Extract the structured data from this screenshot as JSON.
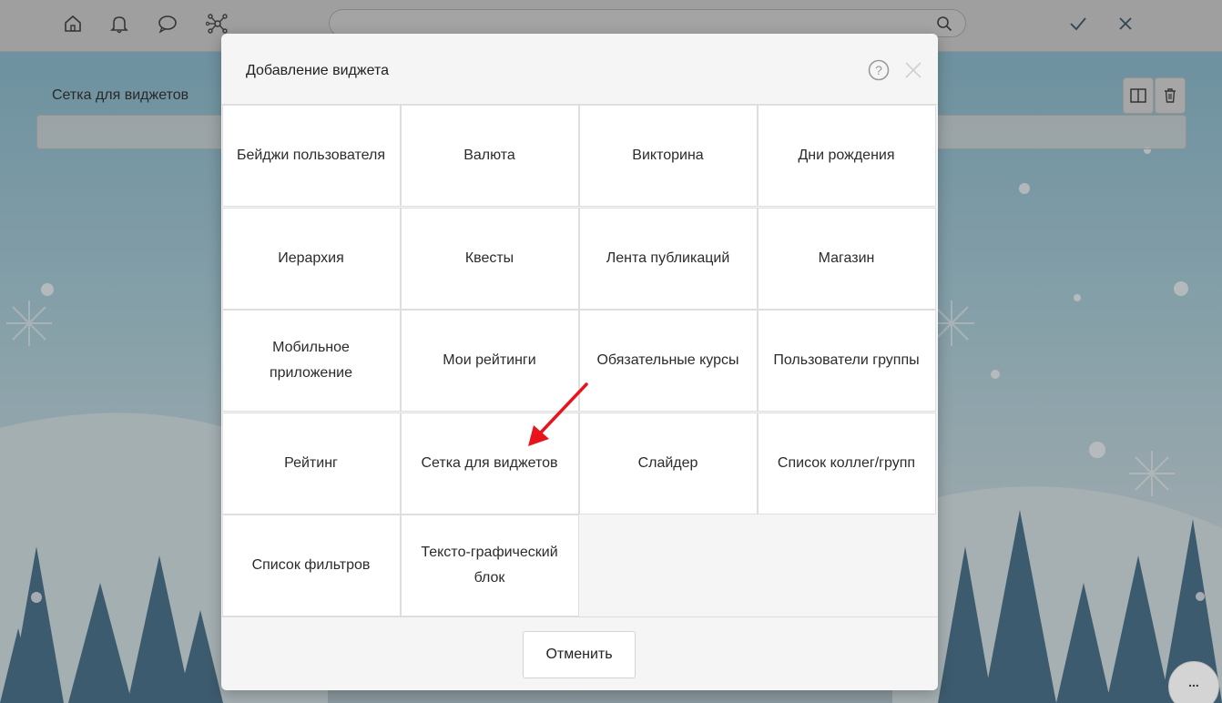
{
  "topbar": {
    "icons": [
      "home-icon",
      "bell-icon",
      "chat-icon",
      "network-icon"
    ],
    "search": {
      "value": "",
      "placeholder": ""
    },
    "confirm_icon": "check-icon",
    "cancel_icon": "close-icon"
  },
  "page": {
    "title": "Сетка для виджетов",
    "more_label": "..."
  },
  "modal": {
    "title": "Добавление виджета",
    "widgets": [
      "Бейджи пользователя",
      "Валюта",
      "Викторина",
      "Дни рождения",
      "Иерархия",
      "Квесты",
      "Лента публикаций",
      "Магазин",
      "Мобильное приложение",
      "Мои рейтинги",
      "Обязательные курсы",
      "Пользователи группы",
      "Рейтинг",
      "Сетка для виджетов",
      "Слайдер",
      "Список коллег/групп",
      "Список фильтров",
      "Текстo-графический блок"
    ],
    "cancel_label": "Отменить"
  },
  "colors": {
    "arrow": "#e8141c",
    "topbar": "#cfcfcf",
    "modal_bg": "#f5f5f5"
  }
}
